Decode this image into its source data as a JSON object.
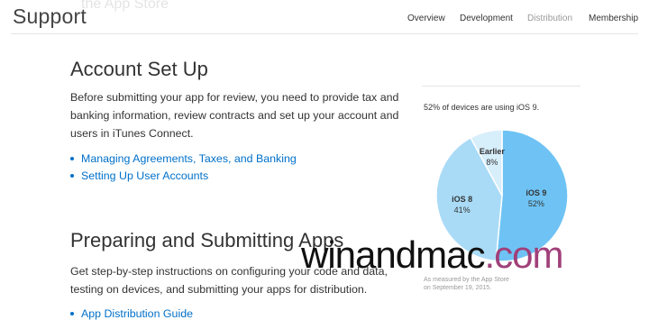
{
  "header": {
    "ghost_text": "the App Store",
    "brand": "Support",
    "nav": [
      {
        "label": "Overview"
      },
      {
        "label": "Development"
      },
      {
        "label": "Distribution"
      },
      {
        "label": "Membership"
      }
    ]
  },
  "sections": {
    "account": {
      "title": "Account Set Up",
      "body": "Before submitting your app for review, you need to provide tax and banking information, review contracts and set up your account and users in iTunes Connect.",
      "links": [
        {
          "label": "Managing Agreements, Taxes, and Banking"
        },
        {
          "label": "Setting Up User Accounts"
        }
      ]
    },
    "submit": {
      "title": "Preparing and Submitting Apps",
      "body": "Get step-by-step instructions on configuring your code and data, testing on devices, and submitting your apps for distribution.",
      "links": [
        {
          "label": "App Distribution Guide"
        }
      ]
    }
  },
  "sidebar": {
    "stat": "52% of devices are using iOS 9.",
    "caption": "As measured by the App Store on September 19, 2015."
  },
  "chart_data": {
    "type": "pie",
    "slices": [
      {
        "label": "iOS 9",
        "value": 52,
        "value_label": "52%",
        "color": "#6ec3f4"
      },
      {
        "label": "iOS 8",
        "value": 41,
        "value_label": "41%",
        "color": "#a9dbf7"
      },
      {
        "label": "Earlier",
        "value": 8,
        "value_label": "8%",
        "color": "#d7eefb"
      }
    ]
  },
  "watermark": {
    "part1": "winandmac",
    "part2": ".com"
  },
  "colors": {
    "link": "#0070c9",
    "nav_active": "#999999"
  }
}
